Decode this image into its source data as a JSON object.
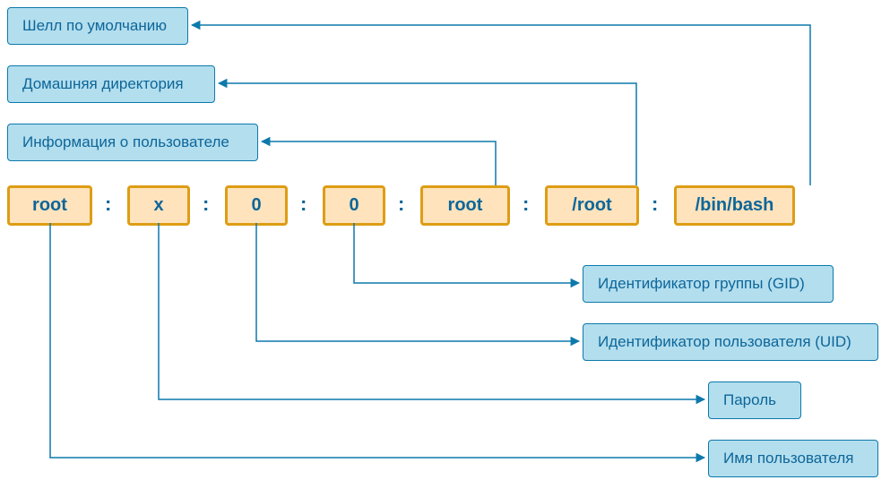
{
  "labels": {
    "shell": "Шелл по умолчанию",
    "homedir": "Домашняя директория",
    "userinfo": "Информация о пользователе",
    "gid": "Идентификатор группы (GID)",
    "uid": "Идентификатор пользователя (UID)",
    "password": "Пароль",
    "username": "Имя пользователя"
  },
  "fields": {
    "username": "root",
    "password": "x",
    "uid": "0",
    "gid": "0",
    "info": "root",
    "home": "/root",
    "shell": "/bin/bash"
  },
  "separator": ":"
}
